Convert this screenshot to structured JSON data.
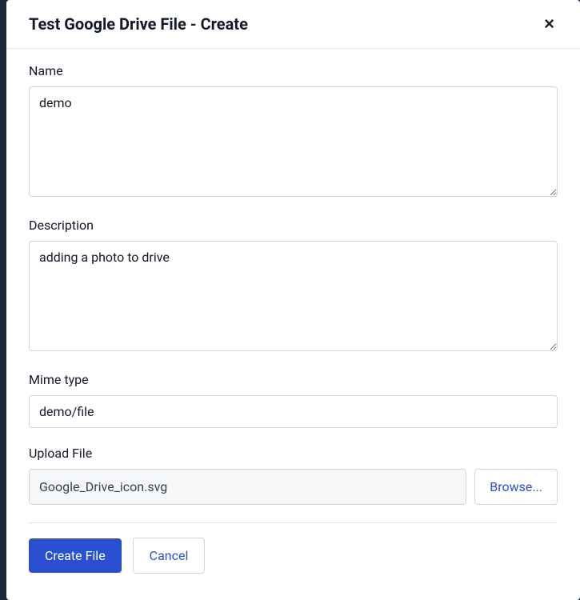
{
  "modal": {
    "title": "Test Google Drive File - Create",
    "close_icon": "×"
  },
  "form": {
    "name": {
      "label": "Name",
      "value": "demo"
    },
    "description": {
      "label": "Description",
      "value": "adding a photo to drive"
    },
    "mime_type": {
      "label": "Mime type",
      "value": "demo/file"
    },
    "upload": {
      "label": "Upload File",
      "filename": "Google_Drive_icon.svg",
      "browse_label": "Browse..."
    }
  },
  "footer": {
    "create_label": "Create File",
    "cancel_label": "Cancel"
  }
}
